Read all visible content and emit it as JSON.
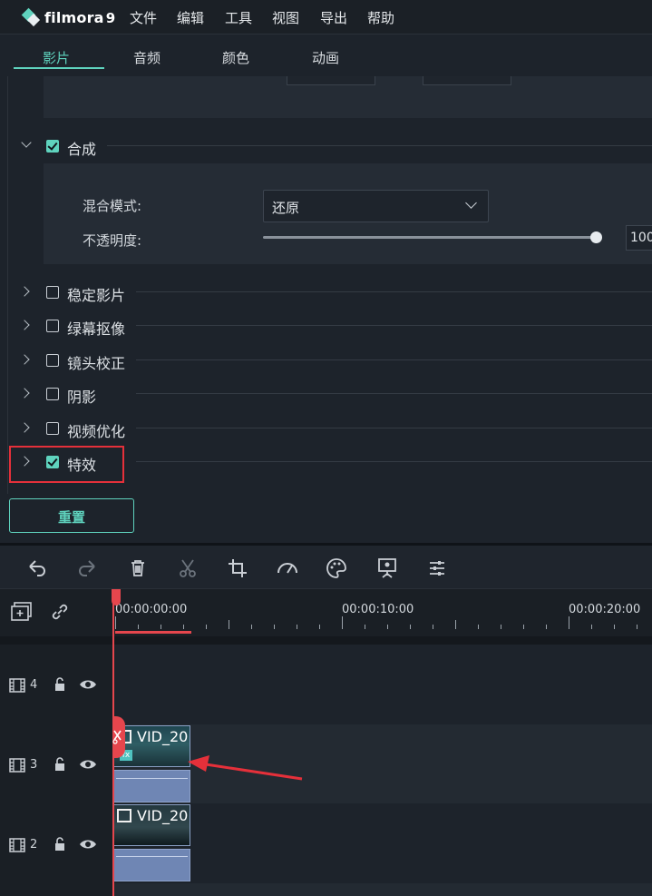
{
  "app": {
    "name": "filmora",
    "version": "9"
  },
  "menu": [
    "文件",
    "编辑",
    "工具",
    "视图",
    "导出",
    "帮助"
  ],
  "tabs": [
    {
      "label": "影片",
      "active": true
    },
    {
      "label": "音频",
      "active": false
    },
    {
      "label": "颜色",
      "active": false
    },
    {
      "label": "动画",
      "active": false
    }
  ],
  "composite": {
    "label": "合成",
    "checked": true,
    "expanded": true,
    "blend_mode_label": "混合模式:",
    "blend_mode_value": "还原",
    "opacity_label": "不透明度:",
    "opacity_value": "100",
    "opacity_fraction": 1.0
  },
  "sections": [
    {
      "label": "稳定影片",
      "checked": false
    },
    {
      "label": "绿幕抠像",
      "checked": false
    },
    {
      "label": "镜头校正",
      "checked": false
    },
    {
      "label": "阴影",
      "checked": false
    },
    {
      "label": "视频优化",
      "checked": false
    },
    {
      "label": "特效",
      "checked": true,
      "highlighted": true
    }
  ],
  "reset_label": "重置",
  "toolbar_icons": [
    "undo-icon",
    "redo-icon",
    "delete-icon",
    "cut-icon",
    "crop-icon",
    "speed-icon",
    "color-icon",
    "green-screen-icon",
    "adjust-icon"
  ],
  "ruler": {
    "labels": [
      "00:00:00:00",
      "00:00:10:00",
      "00:00:20:00"
    ]
  },
  "tracks": [
    {
      "number": "4",
      "clip": null
    },
    {
      "number": "3",
      "clip": "VID_20"
    },
    {
      "number": "2",
      "clip": "VID_20"
    }
  ],
  "colors": {
    "accent": "#5fd3be",
    "highlight": "#e5303a",
    "playhead": "#e5464d",
    "audio_clip": "#6f86b4"
  }
}
